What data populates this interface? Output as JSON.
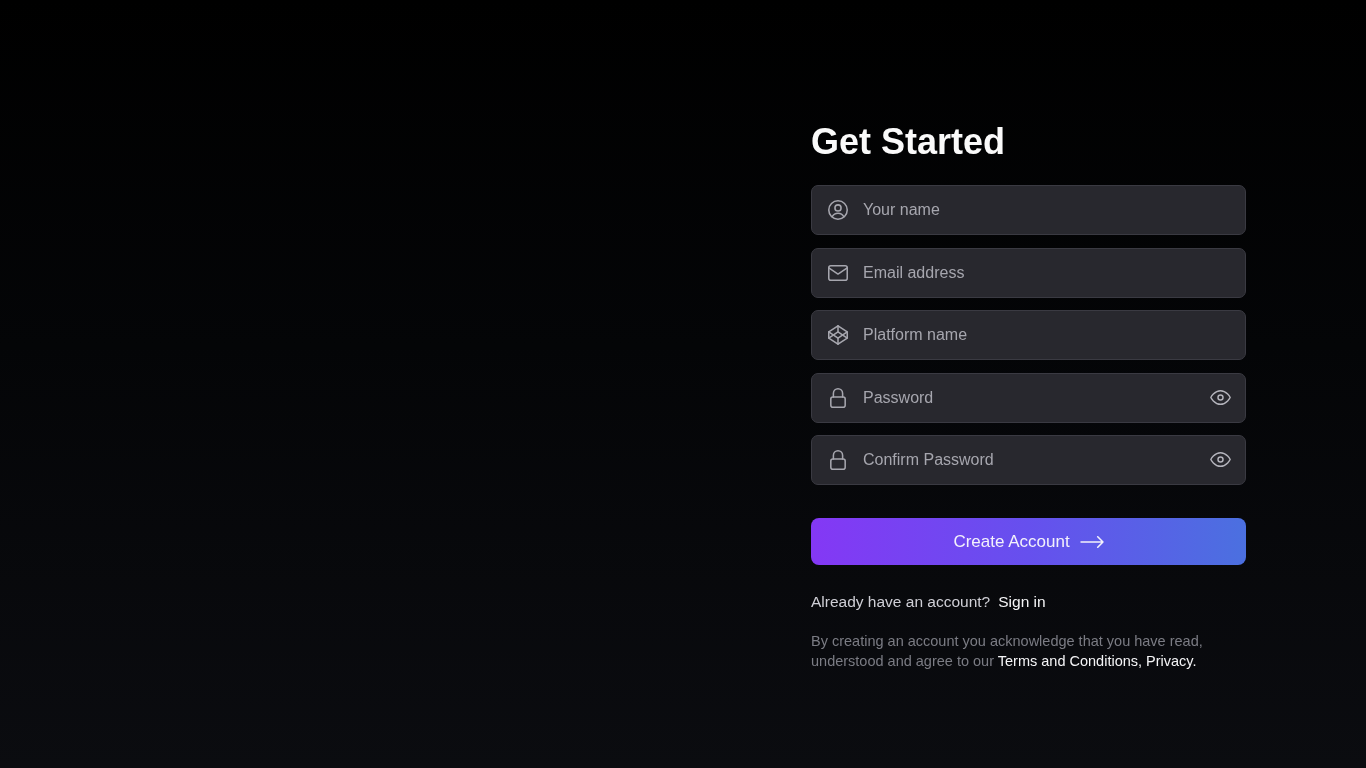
{
  "signup": {
    "title": "Get Started",
    "fields": [
      {
        "kind": "name",
        "placeholder": "Your name"
      },
      {
        "kind": "email",
        "placeholder": "Email address"
      },
      {
        "kind": "platform",
        "placeholder": "Platform name"
      },
      {
        "kind": "password",
        "placeholder": "Password"
      },
      {
        "kind": "password",
        "placeholder": "Confirm Password"
      }
    ],
    "submit_button": "Create Account",
    "sign_in": {
      "prompt": "Already have an account?",
      "link": "Sign in"
    },
    "legal": {
      "text": "By creating an account you acknowledge that you have read, understood and agree to our",
      "link": "Terms and Conditions, Privacy."
    }
  }
}
